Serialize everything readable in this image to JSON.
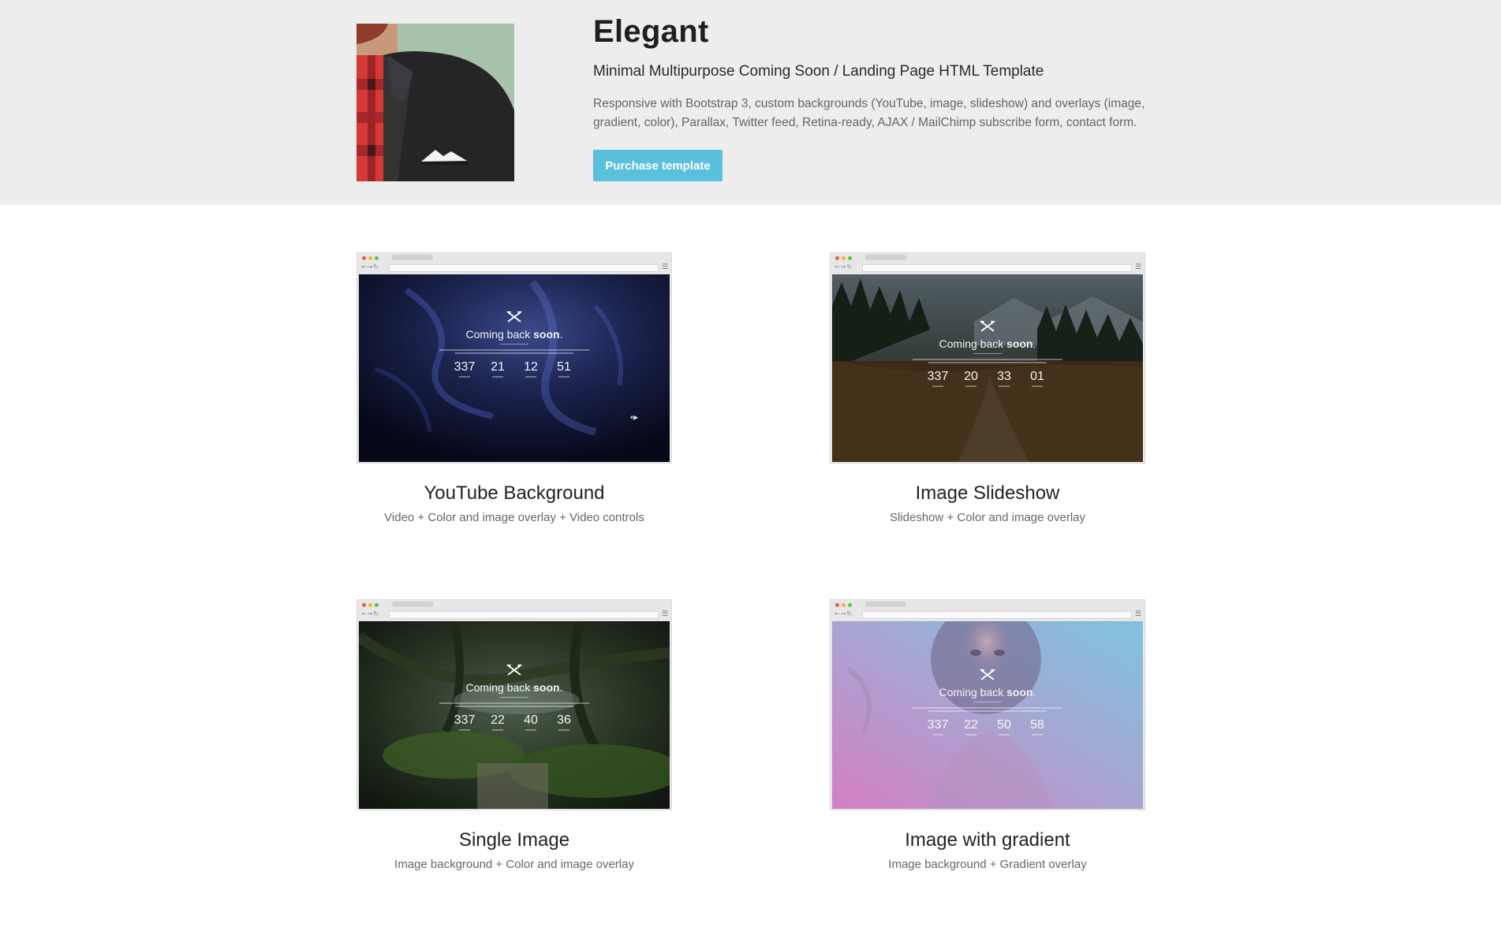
{
  "header": {
    "title": "Elegant",
    "subtitle": "Minimal Multipurpose Coming Soon / Landing Page HTML Template",
    "description": "Responsive with Bootstrap 3, custom backgrounds (YouTube, image, slideshow) and overlays (image, gradient, color), Parallax, Twitter feed, Retina-ready, AJAX / MailChimp subscribe form, contact form.",
    "purchase_label": "Purchase template"
  },
  "screenshot_text": {
    "heading_prefix": "Coming back",
    "heading_bold": "soon",
    "heading_suffix": "."
  },
  "cards": [
    {
      "title": "YouTube Background",
      "subtitle": "Video + Color and image overlay + Video controls",
      "countdown": [
        "337",
        "21",
        "12",
        "51"
      ]
    },
    {
      "title": "Image Slideshow",
      "subtitle": "Slideshow + Color and image overlay",
      "countdown": [
        "337",
        "20",
        "33",
        "01"
      ]
    },
    {
      "title": "Single Image",
      "subtitle": "Image background + Color and image overlay",
      "countdown": [
        "337",
        "22",
        "40",
        "36"
      ]
    },
    {
      "title": "Image with gradient",
      "subtitle": "Image background + Gradient overlay",
      "countdown": [
        "337",
        "22",
        "50",
        "58"
      ]
    }
  ],
  "icons": {
    "logo": "lumberjack-jacket-illustration",
    "screenshot_logo": "crossed-axes-icon",
    "browser_menu": "hamburger-menu-icon",
    "video_controls": "video-controls-icon"
  },
  "colors": {
    "header_bg": "#ededed",
    "button": "#5bc0de"
  }
}
